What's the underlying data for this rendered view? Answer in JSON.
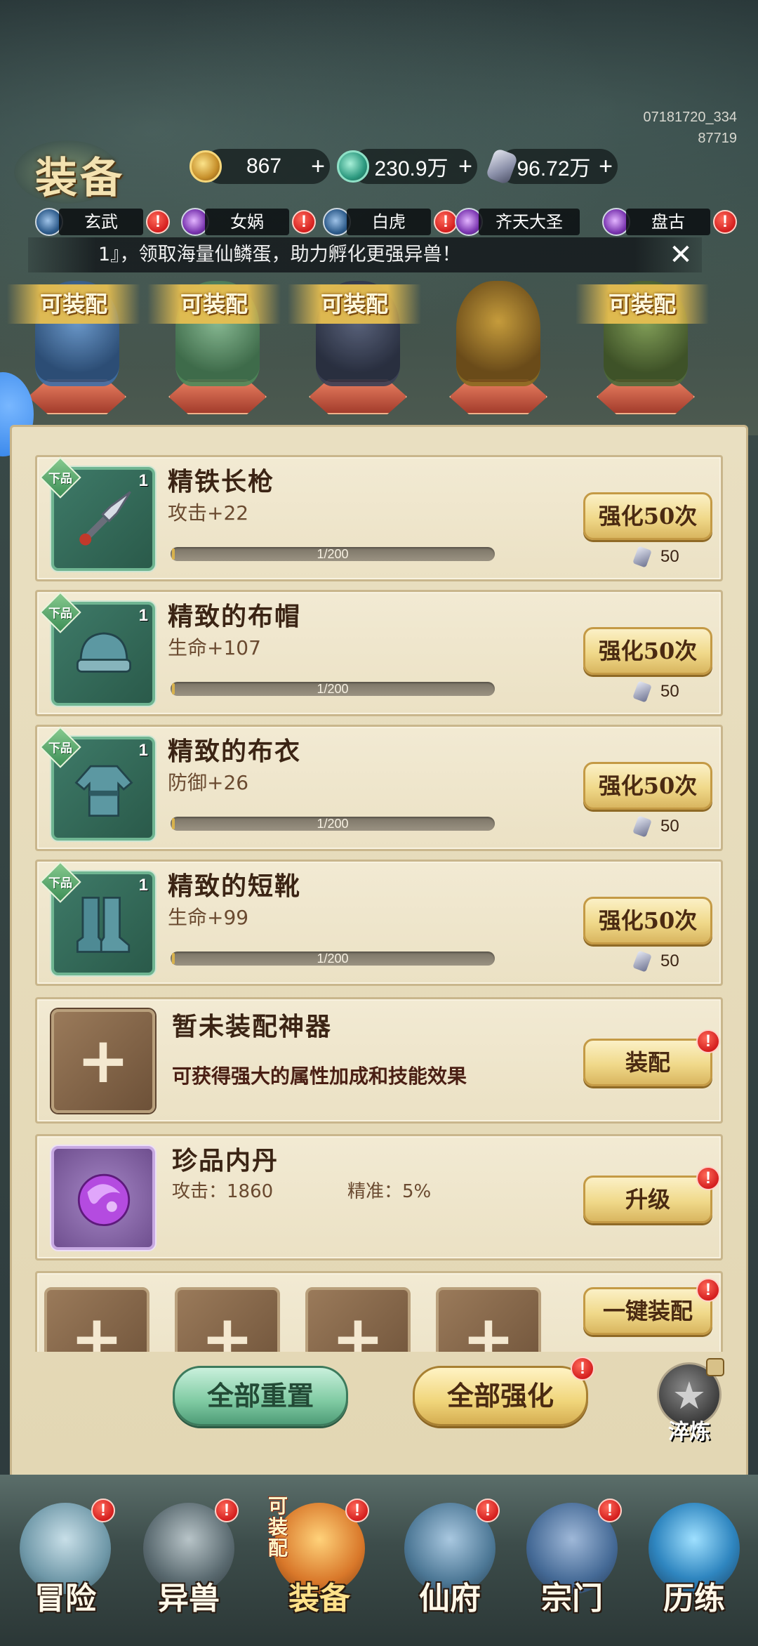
{
  "build_id": [
    "07181720_334",
    "87719"
  ],
  "header": {
    "title": "装备"
  },
  "currencies": [
    {
      "icon": "gold-coin-icon",
      "value": "867",
      "plus": "+"
    },
    {
      "icon": "jade-icon",
      "value": "230.9万",
      "plus": "+"
    },
    {
      "icon": "crystal-icon",
      "value": "96.72万",
      "plus": "+"
    }
  ],
  "beast_tabs": [
    {
      "label": "玄武",
      "alert": "!"
    },
    {
      "label": "女娲",
      "alert": "!"
    },
    {
      "label": "白虎",
      "alert": "!"
    },
    {
      "label": "齐天大圣",
      "alert": ""
    },
    {
      "label": "盘古",
      "alert": "!"
    }
  ],
  "marquee": {
    "text": "1』，领取海量仙鳞蛋，助力孵化更强异兽！",
    "close": "✕"
  },
  "heroes": [
    {
      "banner": "可装配",
      "color": "#3f6fa8"
    },
    {
      "banner": "可装配",
      "color": "#4e8a5a"
    },
    {
      "banner": "可装配",
      "color": "#3a3f55"
    },
    {
      "banner": "",
      "color": "#8a6a20"
    },
    {
      "banner": "可装配",
      "color": "#4f6a3a"
    }
  ],
  "equipment": [
    {
      "quality": "下品",
      "count": "1",
      "name": "精铁长枪",
      "stat": "攻击+22",
      "progress_text": "1/200",
      "progress": 0.005,
      "button": "强化50次",
      "cost": "50",
      "art": "spear"
    },
    {
      "quality": "下品",
      "count": "1",
      "name": "精致的布帽",
      "stat": "生命+107",
      "progress_text": "1/200",
      "progress": 0.005,
      "button": "强化50次",
      "cost": "50",
      "art": "hat"
    },
    {
      "quality": "下品",
      "count": "1",
      "name": "精致的布衣",
      "stat": "防御+26",
      "progress_text": "1/200",
      "progress": 0.005,
      "button": "强化50次",
      "cost": "50",
      "art": "robe"
    },
    {
      "quality": "下品",
      "count": "1",
      "name": "精致的短靴",
      "stat": "生命+99",
      "progress_text": "1/200",
      "progress": 0.005,
      "button": "强化50次",
      "cost": "50",
      "art": "boots"
    }
  ],
  "artifact": {
    "title": "暂未装配神器",
    "desc": "可获得强大的属性加成和技能效果",
    "button": "装配",
    "alert": "!",
    "plus": "+"
  },
  "core": {
    "title": "珍品内丹",
    "stat1": "攻击：1860",
    "stat2": "精准：5%",
    "button": "升级",
    "alert": "!"
  },
  "slots": {
    "button": "一键装配",
    "alert": "!",
    "plus": "+"
  },
  "actions": {
    "reset_all": "全部重置",
    "enhance_all": "全部强化",
    "enhance_alert": "!",
    "refine": "淬炼"
  },
  "nav": [
    {
      "label": "冒险",
      "alert": "!",
      "badge": ""
    },
    {
      "label": "异兽",
      "alert": "!",
      "badge": ""
    },
    {
      "label": "装备",
      "alert": "!",
      "badge": "可装配"
    },
    {
      "label": "仙府",
      "alert": "!",
      "badge": ""
    },
    {
      "label": "宗门",
      "alert": "!",
      "badge": ""
    },
    {
      "label": "历练",
      "alert": "",
      "badge": ""
    }
  ]
}
